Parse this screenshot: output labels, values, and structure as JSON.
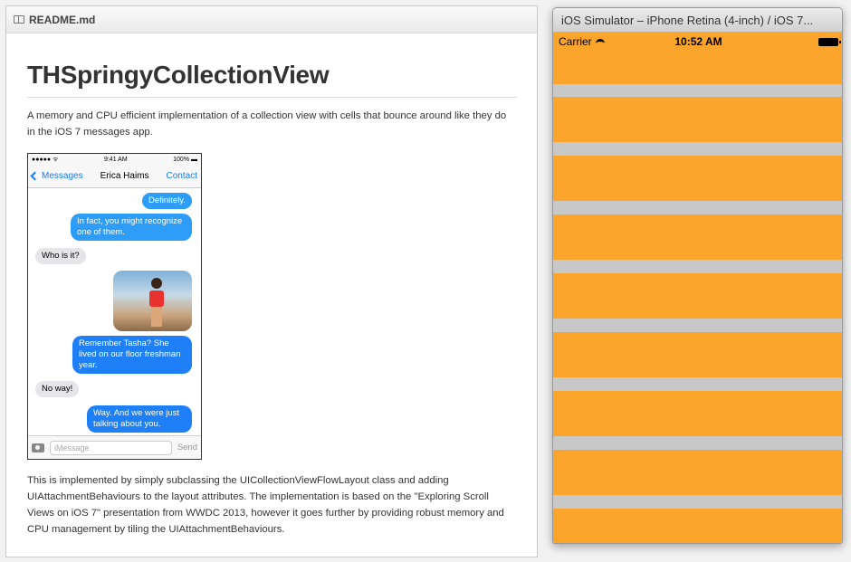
{
  "readme": {
    "filename": "README.md",
    "title": "THSpringyCollectionView",
    "intro": "A memory and CPU efficient implementation of a collection view with cells that bounce around like they do in the iOS 7 messages app.",
    "body": "This is implemented by simply subclassing the UICollectionViewFlowLayout class and adding UIAttachmentBehaviours to the layout attributes. The implementation is based on the \"Exploring Scroll Views on iOS 7\" presentation from WWDC 2013, however it goes further by providing robust memory and CPU management by tiling the UIAttachmentBehaviours."
  },
  "phone": {
    "status": {
      "signal": "●●●●● ᯤ",
      "time": "9:41 AM",
      "battery": "100% ▬"
    },
    "nav": {
      "back": "Messages",
      "name": "Erica Haims",
      "contact": "Contact"
    },
    "messages": [
      {
        "text": "Definitely.",
        "side": "out"
      },
      {
        "text": "In fact, you might recognize one of them.",
        "side": "out"
      },
      {
        "text": "Who is it?",
        "side": "in"
      },
      {
        "text": "Remember Tasha? She lived on our floor freshman year.",
        "side": "out"
      },
      {
        "text": "No way!",
        "side": "in"
      },
      {
        "text": "Way. And we were just talking about you.",
        "side": "out"
      }
    ],
    "input_placeholder": "iMessage",
    "send": "Send"
  },
  "simulator": {
    "window_title": "iOS Simulator – iPhone Retina (4-inch) / iOS 7...",
    "carrier": "Carrier",
    "time": "10:52 AM",
    "cell_color": "#fba52c",
    "gap_color": "#c8c8c8"
  }
}
